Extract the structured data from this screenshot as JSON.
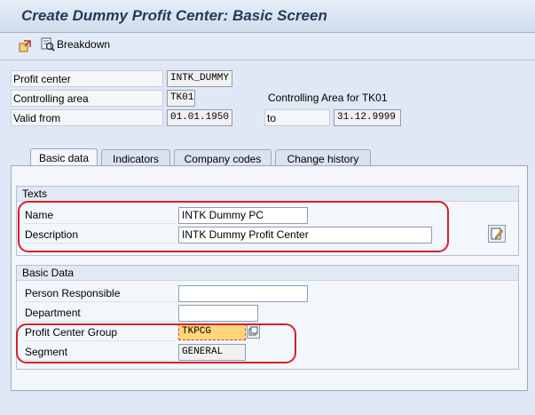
{
  "window": {
    "title": "Create Dummy Profit Center: Basic Screen"
  },
  "toolbar": {
    "breakdown_label": "Breakdown"
  },
  "header": {
    "profit_center_label": "Profit center",
    "profit_center_value": "INTK_DUMMY",
    "controlling_area_label": "Controlling area",
    "controlling_area_value": "TK01",
    "controlling_area_desc": "Controlling Area for TK01",
    "valid_from_label": "Valid from",
    "valid_from_value": "01.01.1950",
    "to_label": "to",
    "valid_to_value": "31.12.9999"
  },
  "tabs": [
    {
      "label": "Basic data"
    },
    {
      "label": "Indicators"
    },
    {
      "label": "Company codes"
    },
    {
      "label": "Change history"
    }
  ],
  "texts": {
    "group_title": "Texts",
    "name_label": "Name",
    "name_value": "INTK Dummy PC",
    "description_label": "Description",
    "description_value": "INTK Dummy Profit Center"
  },
  "basic_data": {
    "group_title": "Basic Data",
    "person_responsible_label": "Person Responsible",
    "person_responsible_value": "",
    "department_label": "Department",
    "department_value": "",
    "pc_group_label": "Profit Center Group",
    "pc_group_value": "TKPCG",
    "segment_label": "Segment",
    "segment_value": "GENERAL"
  }
}
